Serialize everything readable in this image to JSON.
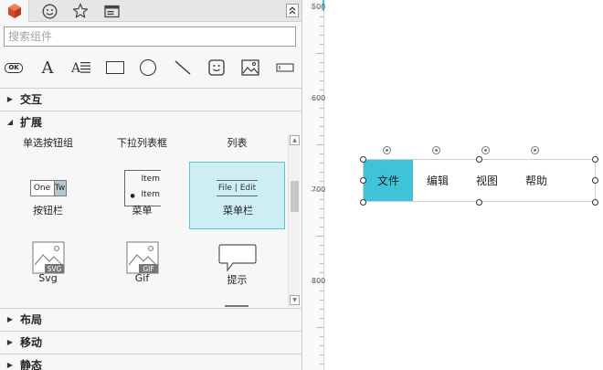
{
  "panel": {
    "tabs": [
      "components-tab",
      "emoji-tab",
      "favorites-tab",
      "masters-tab"
    ],
    "search_placeholder": "搜索组件",
    "tools": [
      "button-tool",
      "text-tool",
      "paragraph-tool",
      "rectangle-tool",
      "ellipse-tool",
      "line-tool",
      "emoji-tool",
      "image-tool",
      "input-tool"
    ],
    "button_tool_text": "OK",
    "text_tool_text": "A",
    "sections": {
      "interaction": "交互",
      "extension": "扩展",
      "layout": "布局",
      "motion": "移动",
      "static": "静态"
    },
    "top_row_labels": [
      "单选按钮组",
      "下拉列表框",
      "列表"
    ],
    "components": [
      {
        "label": "按钮栏",
        "icon": "button-bar-icon",
        "preview": [
          "One",
          "Tw"
        ]
      },
      {
        "label": "菜单",
        "icon": "menu-icon",
        "preview": [
          "Item",
          "Item"
        ]
      },
      {
        "label": "菜单栏",
        "icon": "menubar-icon",
        "preview": "File | Edit",
        "selected": true
      },
      {
        "label": "Svg",
        "icon": "svg-image-icon",
        "badge": "SVG"
      },
      {
        "label": "Gif",
        "icon": "gif-image-icon",
        "badge": "GIF"
      },
      {
        "label": "提示",
        "icon": "tooltip-icon"
      }
    ]
  },
  "ruler": {
    "labels": [
      "500",
      "600",
      "700",
      "800"
    ]
  },
  "canvas": {
    "menubar_items": [
      "文件",
      "编辑",
      "视图",
      "帮助"
    ],
    "active_item": "文件",
    "accent": "#3fc3d9"
  },
  "colors": {
    "accent": "#3fc3d9",
    "selection_fill": "#cdeef3",
    "brand": "#e05a33"
  }
}
